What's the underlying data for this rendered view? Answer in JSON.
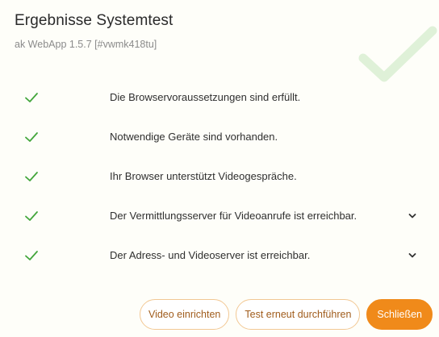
{
  "dialog": {
    "title": "Ergebnisse Systemtest",
    "subtitle": "ak WebApp 1.5.7 [#vwmk418tu]"
  },
  "checks": [
    {
      "label": "Die Browservoraussetzungen sind erfüllt.",
      "status": "passed",
      "expandable": false
    },
    {
      "label": "Notwendige Geräte sind vorhanden.",
      "status": "passed",
      "expandable": false
    },
    {
      "label": "Ihr Browser unterstützt Videogespräche.",
      "status": "passed",
      "expandable": false
    },
    {
      "label": "Der Vermittlungsserver für Videoanrufe ist erreichbar.",
      "status": "passed",
      "expandable": true
    },
    {
      "label": "Der Adress- und Videoserver ist erreichbar.",
      "status": "passed",
      "expandable": true
    }
  ],
  "footer": {
    "setup_video_label": "Video einrichten",
    "retry_label": "Test erneut durchführen",
    "close_label": "Schließen"
  },
  "colors": {
    "check_green": "#43a63c",
    "accent_orange": "#f08a1a",
    "watermark_green": "#dff1d8"
  },
  "icons": {
    "status": "check-icon",
    "expand": "chevron-down-icon",
    "watermark": "large-check-icon"
  }
}
